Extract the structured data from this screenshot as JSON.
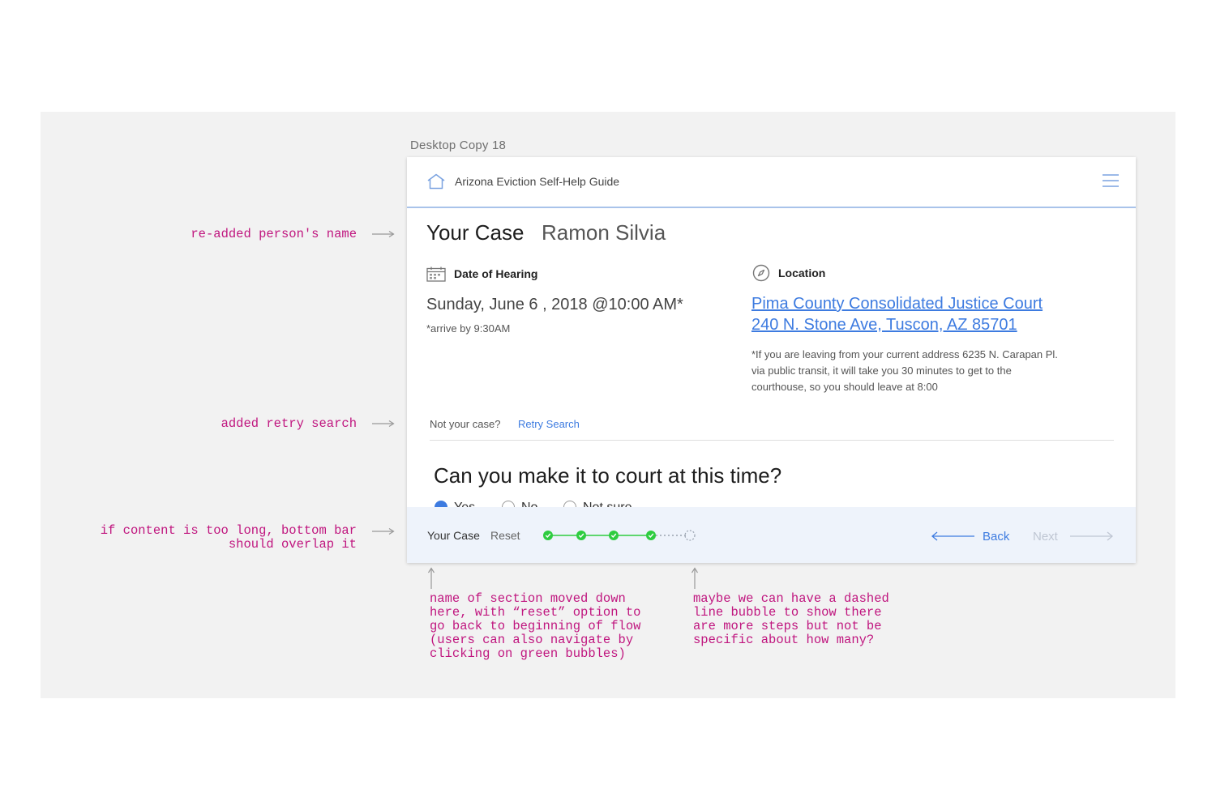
{
  "artboard_label": "Desktop Copy 18",
  "header": {
    "app_title": "Arizona Eviction Self-Help Guide",
    "home_icon": "home-icon",
    "menu_icon": "hamburger-menu-icon"
  },
  "case": {
    "title": "Your Case",
    "person_name": "Ramon Silvia"
  },
  "hearing": {
    "label": "Date of Hearing",
    "icon": "calendar-icon",
    "date": "Sunday, June 6 , 2018 @10:00 AM*",
    "note": "*arrive by 9:30AM"
  },
  "location": {
    "label": "Location",
    "icon": "compass-icon",
    "court_name": "Pima County Consolidated Justice Court",
    "address": "240 N. Stone Ave, Tuscon, AZ 85701",
    "transit_note": "*If you are leaving from your current address 6235 N. Carapan Pl. via public transit, it will take you 30 minutes to get to the courthouse, so you should leave at 8:00"
  },
  "retry": {
    "prompt": "Not your case?",
    "link": "Retry Search"
  },
  "question": {
    "text": "Can you make it to court at this time?",
    "options": [
      {
        "label": "Yes",
        "checked": true
      },
      {
        "label": "No",
        "checked": false
      },
      {
        "label": "Not sure",
        "checked": false
      }
    ]
  },
  "bottom_bar": {
    "section_label": "Your Case",
    "reset_label": "Reset",
    "steps_completed": 4,
    "has_more_steps_indicator": true,
    "back_label": "Back",
    "next_label": "Next",
    "colors": {
      "step_complete": "#2ecc40",
      "link": "#3d7be0",
      "disabled": "#bfc6d3",
      "bar_background": "#eef3fb"
    }
  },
  "annotations": {
    "person_name": "re-added person's name",
    "retry": "added retry search",
    "overlap": "if content is too long, bottom bar\nshould overlap it",
    "section_name": "name of section moved down\nhere, with “reset” option to\ngo back to beginning of flow\n(users can also navigate by\nclicking on green bubbles)",
    "dashed_bubble": "maybe we can have a dashed\nline bubble to show there\nare more steps but not be\nspecific about how many?",
    "color": "#c0167f"
  }
}
